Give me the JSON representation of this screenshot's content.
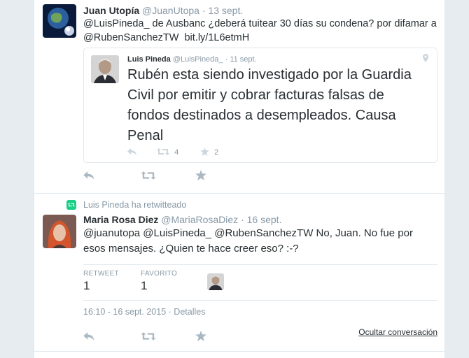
{
  "tweet1": {
    "fullname": "Juan Utopía",
    "username": "@JuanUtopa",
    "separator": "·",
    "time": "13 sept.",
    "text_main": "@LuisPineda_ de Ausbanc ¿deberá tuitear 30 días su condena? por difamar a @RubenSanchezTW",
    "text_link": "bit.ly/1L6etmH",
    "quote": {
      "fullname": "Luis Pineda",
      "username": "@LuisPineda_",
      "separator": "·",
      "time": "11 sept.",
      "text": "Rubén esta siendo investigado por la Guardia Civil por emitir y cobrar facturas falsas de fondos destinados a desempleados. Causa Penal",
      "retweets": "4",
      "favorites": "2"
    }
  },
  "tweet2": {
    "context": "Luis Pineda ha retwitteado",
    "fullname": "Maria Rosa Diez",
    "username": "@MariaRosaDiez",
    "separator": "·",
    "time": "16 sept.",
    "text": "@juanutopa @LuisPineda_ @RubenSanchezTW No, Juan. No fue por esos mensajes. ¿Quien te hace creer eso? :-?",
    "stats": {
      "retweet_label": "RETWEET",
      "retweet_value": "1",
      "favorite_label": "FAVORITO",
      "favorite_value": "1"
    },
    "meta_time": "16:10 - 16 sept. 2015",
    "meta_separator": "·",
    "meta_details": "Detalles",
    "hide_conversation": "Ocultar conversación"
  },
  "icons": {
    "reply": "reply-icon",
    "retweet": "retweet-icon",
    "favorite": "star-icon",
    "location": "location-pin-icon"
  },
  "colors": {
    "background": "#e6ecf0",
    "text": "#292f33",
    "muted": "#8899a6",
    "icon": "#aab8c2",
    "retweet_green": "#19cf86"
  }
}
